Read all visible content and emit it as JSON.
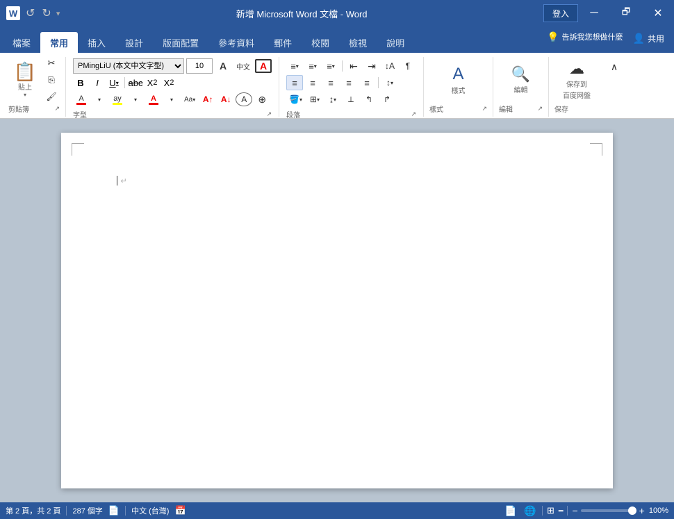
{
  "titlebar": {
    "title": "新增 Microsoft Word 文檔 - Word",
    "login_label": "登入",
    "undo_icon": "↺",
    "redo_icon": "↻",
    "separator_icon": "▾",
    "minimize_icon": "─",
    "restore_icon": "❐",
    "close_icon": "✕"
  },
  "tabs": {
    "items": [
      "檔案",
      "常用",
      "插入",
      "設計",
      "版面配置",
      "參考資料",
      "郵件",
      "校閱",
      "檢視",
      "說明"
    ],
    "active": "常用",
    "share_label": "共用",
    "search_placeholder": "告訴我您想做什麼"
  },
  "ribbon": {
    "font_name": "PMingLiU (本文中文字型)",
    "font_size": "10",
    "font_size_unit": "中文",
    "groups": [
      {
        "label": "剪貼簿",
        "buttons_large": [
          "貼上"
        ],
        "buttons": [
          "剪下",
          "複製",
          "複製格式"
        ]
      },
      {
        "label": "字型",
        "buttons": [
          "B",
          "I",
          "U",
          "abc",
          "X₂",
          "X²",
          "A",
          "a",
          "A↑",
          "A↓",
          "A"
        ]
      },
      {
        "label": "段落",
        "buttons": [
          "≡",
          "≡",
          "≡",
          "≡",
          "≡",
          "↑",
          "↓"
        ]
      },
      {
        "label": "樣式",
        "buttons": [
          "樣式"
        ]
      },
      {
        "label": "編輯",
        "buttons": [
          "編輯"
        ]
      },
      {
        "label": "保存",
        "buttons": [
          "保存到百度网盤"
        ]
      }
    ]
  },
  "document": {
    "page_content": "↵"
  },
  "statusbar": {
    "page_info": "第 2 頁，共 2 頁",
    "word_count": "287 個字",
    "language": "中文 (台灣)",
    "zoom_level": "100%"
  }
}
